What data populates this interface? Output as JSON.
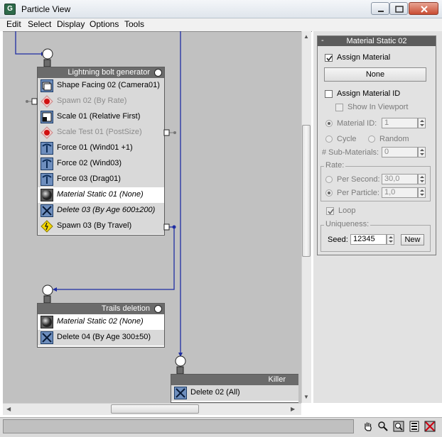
{
  "window": {
    "title": "Particle View"
  },
  "menu": [
    "Edit",
    "Select",
    "Display",
    "Options",
    "Tools"
  ],
  "events": {
    "lightning": {
      "title": "Lightning bolt generator",
      "operators": [
        {
          "label": "Shape Facing 02 (Camera01)",
          "icon": "shape-facing-icon",
          "state": "normal"
        },
        {
          "label": "Spawn 02 (By Rate)",
          "icon": "spawn-test-icon",
          "state": "disabled"
        },
        {
          "label": "Scale 01 (Relative First)",
          "icon": "scale-icon",
          "state": "normal"
        },
        {
          "label": "Scale Test 01 (PostSize)",
          "icon": "scale-test-icon",
          "state": "disabled"
        },
        {
          "label": "Force 01 (Wind01 +1)",
          "icon": "force-icon",
          "state": "normal"
        },
        {
          "label": "Force 02 (Wind03)",
          "icon": "force-icon",
          "state": "normal"
        },
        {
          "label": "Force 03 (Drag01)",
          "icon": "force-icon",
          "state": "normal"
        },
        {
          "label": "Material Static 01 (None)",
          "icon": "material-static-icon",
          "state": "italic"
        },
        {
          "label": "Delete 03 (By Age 600±200)",
          "icon": "delete-icon",
          "state": "italic"
        },
        {
          "label": "Spawn 03 (By Travel)",
          "icon": "spawn-icon",
          "state": "normal"
        }
      ]
    },
    "trails": {
      "title": "Trails deletion",
      "operators": [
        {
          "label": "Material Static 02 (None)",
          "icon": "material-static-icon",
          "state": "selected"
        },
        {
          "label": "Delete 04 (By Age 300±50)",
          "icon": "delete-icon",
          "state": "normal"
        }
      ]
    },
    "killer": {
      "title": "Killer",
      "operators": [
        {
          "label": "Delete 02 (All)",
          "icon": "delete-icon",
          "state": "normal"
        }
      ]
    }
  },
  "panel": {
    "rollout_title": "Material Static 02",
    "rollout_toggle": "-",
    "assign_material": {
      "label": "Assign Material",
      "checked": true
    },
    "material_button": "None",
    "assign_material_id": {
      "label": "Assign Material ID",
      "checked": false
    },
    "show_in_viewport": {
      "label": "Show In Viewport",
      "checked": false
    },
    "material_id": {
      "label": "Material ID:",
      "value": "1"
    },
    "cycle": "Cycle",
    "random": "Random",
    "sub_materials": {
      "label": "# Sub-Materials:",
      "value": "0"
    },
    "rate": {
      "group_label": "Rate:",
      "per_second": {
        "label": "Per Second:",
        "value": "30,0"
      },
      "per_particle": {
        "label": "Per Particle:",
        "value": "1,0"
      }
    },
    "loop": {
      "label": "Loop",
      "checked": true
    },
    "uniqueness": {
      "group_label": "Uniqueness:",
      "seed_label": "Seed:",
      "seed_value": "12345",
      "new_button": "New"
    }
  },
  "status_icons": [
    "pan-hand-icon",
    "zoom-icon",
    "zoom-region-icon",
    "zoom-extents-icon",
    "no-zoom-icon"
  ],
  "colors": {
    "wire": "#1f2ea3",
    "graph_bg": "#c1c1c1",
    "event_head": "#6b6b6b",
    "operator_bg": "#d9d9d9"
  }
}
